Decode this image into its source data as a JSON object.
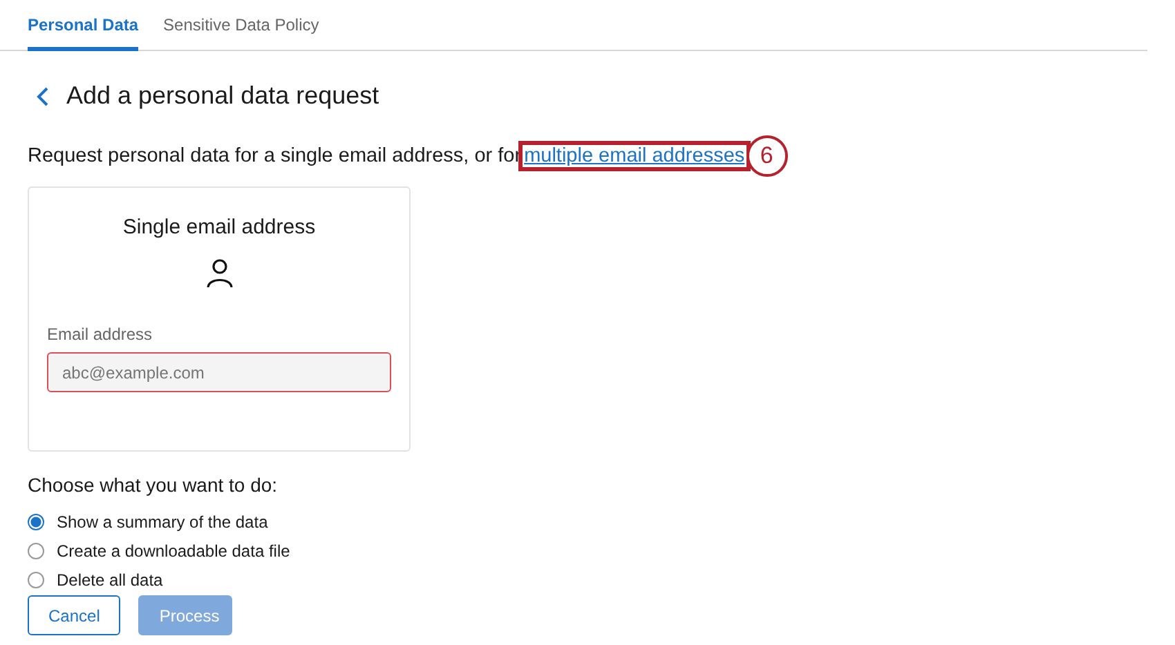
{
  "tabs": [
    {
      "label": "Personal Data",
      "selected": true
    },
    {
      "label": "Sensitive Data Policy",
      "selected": false
    }
  ],
  "page_title": "Add a personal data request",
  "intro": {
    "text": "Request personal data for a single email address, or for",
    "link": "multiple email addresses"
  },
  "callout": {
    "number": "6"
  },
  "card": {
    "title": "Single email address",
    "field": {
      "label": "Email address",
      "placeholder": "abc@example.com",
      "invalid": true
    }
  },
  "options_heading": "Choose what you want to do:",
  "options": [
    {
      "label": "Show a summary of the data",
      "selected": true
    },
    {
      "label": "Create a downloadable data file",
      "selected": false
    },
    {
      "label": "Delete all data",
      "selected": false
    }
  ],
  "buttons": [
    {
      "label": "Cancel",
      "kind": "secondary",
      "disabled": false
    },
    {
      "label": "Process",
      "kind": "primary",
      "disabled": true
    }
  ]
}
